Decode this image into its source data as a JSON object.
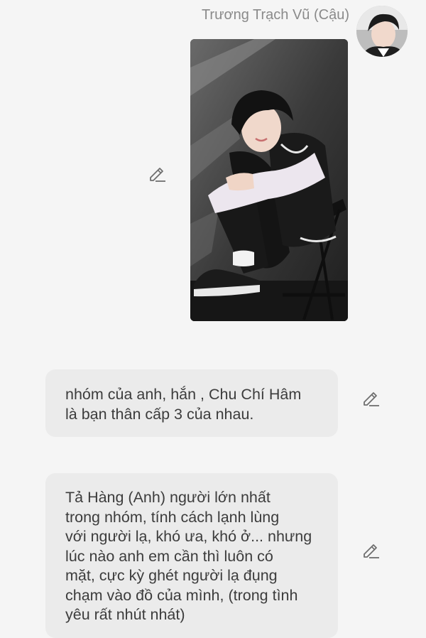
{
  "header": {
    "sender_name": "Trương Trạch Vũ (Cậu)",
    "avatar_icon": "profile-photo-icon"
  },
  "photo_message": {
    "image_label": "photo-of-young-man-sitting-on-chair",
    "edit_icon": "pencil-icon"
  },
  "messages": [
    {
      "lines": [
        "nhóm của anh, hắn , Chu Chí Hâm",
        "là bạn thân cấp 3 của nhau."
      ],
      "edit_icon": "pencil-icon"
    },
    {
      "lines": [
        "Tả Hàng (Anh) người lớn nhất",
        "trong nhóm, tính cách lạnh lùng",
        "với người lạ, khó ưa, khó ở... nhưng",
        "lúc nào anh em cần thì luôn có",
        "mặt, cực kỳ ghét người lạ đụng",
        "chạm vào đồ của mình, (trong tình",
        "yêu rất nhút nhát)"
      ],
      "edit_icon": "pencil-icon"
    }
  ],
  "colors": {
    "background": "#f5f5f5",
    "bubble": "#ebebeb",
    "name_text": "#8a8a8a",
    "message_text": "#3c3c3c"
  }
}
